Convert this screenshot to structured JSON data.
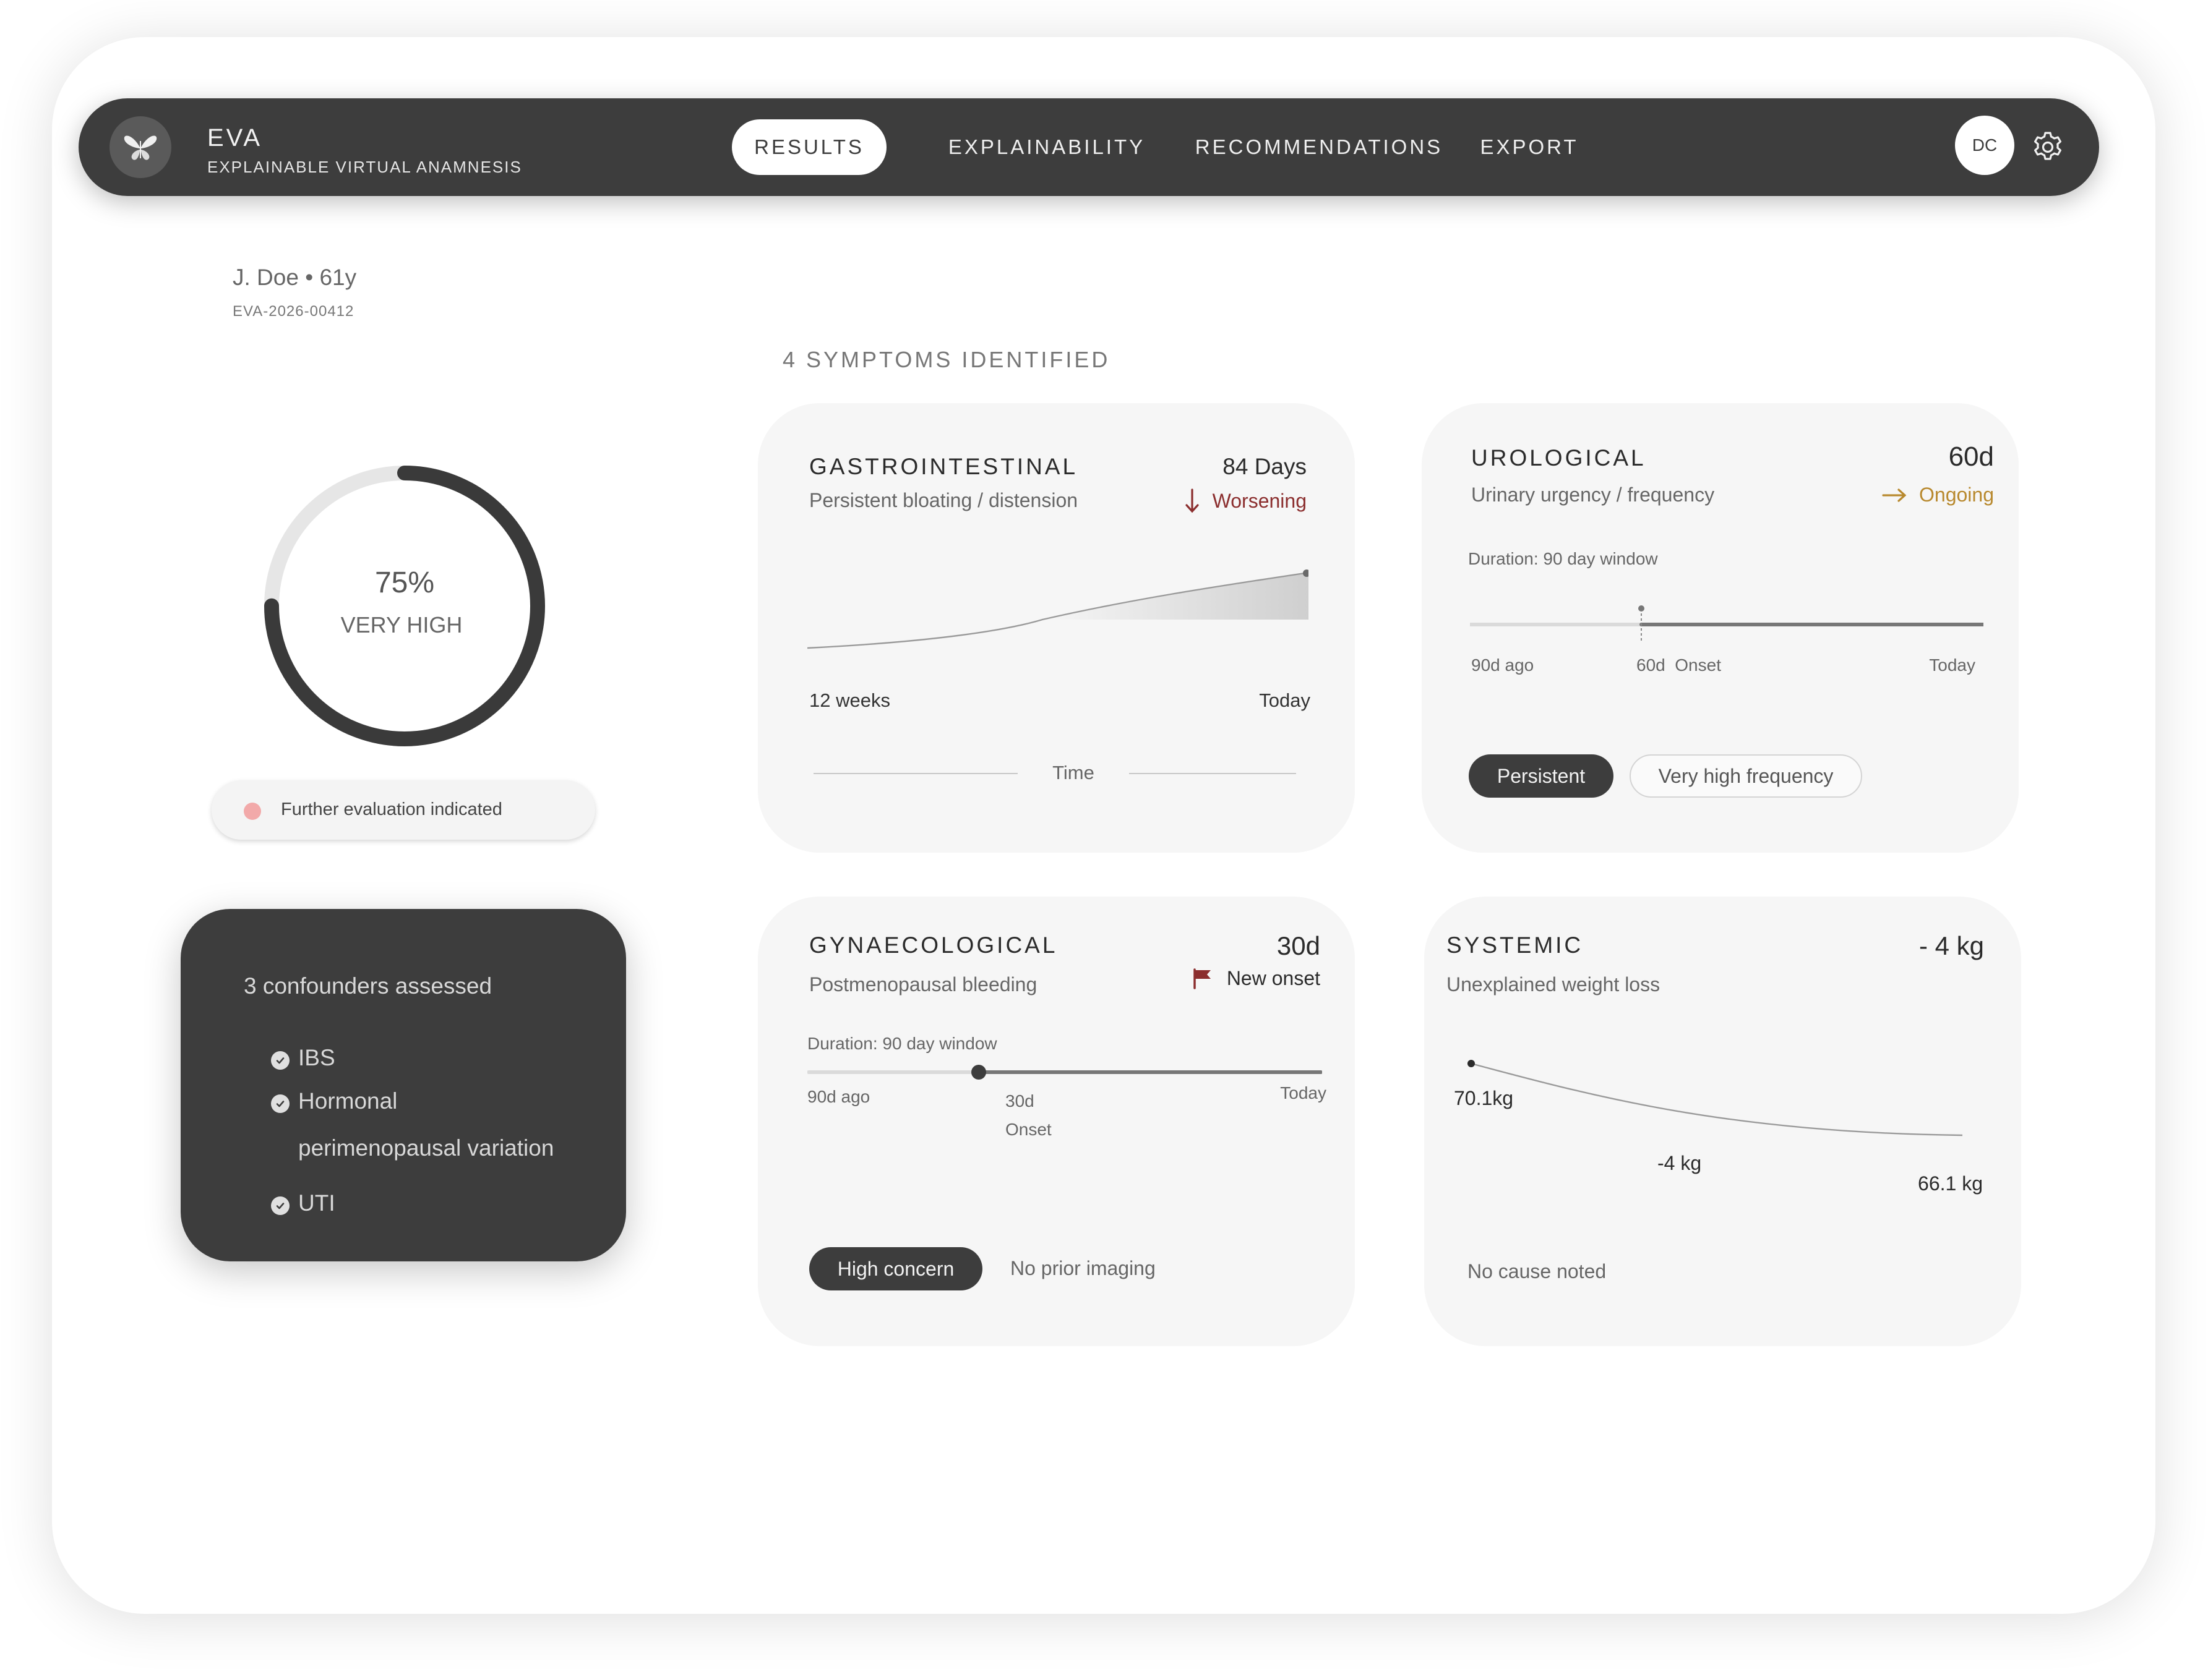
{
  "app": {
    "title": "EVA",
    "subtitle": "EXPLAINABLE VIRTUAL ANAMNESIS",
    "logo_icon": "butterfly-icon"
  },
  "nav": {
    "tabs": [
      {
        "label": "RESULTS",
        "active": true
      },
      {
        "label": "EXPLAINABILITY",
        "active": false
      },
      {
        "label": "RECOMMENDATIONS",
        "active": false
      },
      {
        "label": "EXPORT",
        "active": false
      }
    ],
    "user_initials": "DC",
    "settings_icon": "gear-icon"
  },
  "patient": {
    "name_age": "J. Doe • 61y",
    "id": "EVA-2026-00412"
  },
  "risk": {
    "percent_label": "75%",
    "percent_value": 75,
    "level": "VERY HIGH",
    "status": "Further evaluation indicated",
    "status_color": "#f2a9a9"
  },
  "confounders": {
    "title": "3 confounders assessed",
    "items": [
      {
        "line1": "IBS",
        "line2": ""
      },
      {
        "line1": "Hormonal",
        "line2": "perimenopausal variation"
      },
      {
        "line1": "UTI",
        "line2": ""
      }
    ]
  },
  "symptoms": {
    "heading": "4 SYMPTOMS IDENTIFIED",
    "gastro": {
      "title": "GASTROINTESTINAL",
      "subtitle": "Persistent bloating / distension",
      "value": "84 Days",
      "trend": "Worsening",
      "trend_color": "#8b2e2e",
      "x_start": "12 weeks",
      "x_end": "Today",
      "axis_label": "Time"
    },
    "uro": {
      "title": "UROLOGICAL",
      "subtitle": "Urinary urgency / frequency",
      "value": "60d",
      "trend": "Ongoing",
      "trend_color": "#b8892e",
      "window": "Duration: 90 day window",
      "t_start": "90d ago",
      "t_mid": "60d",
      "t_mid_label": "Onset",
      "t_end": "Today",
      "onset_fraction": 0.3333,
      "tags": [
        "Persistent",
        "Very high frequency"
      ]
    },
    "gyn": {
      "title": "GYNAECOLOGICAL",
      "subtitle": "Postmenopausal bleeding",
      "value": "30d",
      "flag": "New onset",
      "flag_color": "#8b2e2e",
      "window": "Duration: 90 day window",
      "t_start": "90d ago",
      "t_mid": "30d",
      "t_mid_label": "Onset",
      "t_end": "Today",
      "onset_fraction": 0.3333,
      "tags": [
        "High concern",
        "No prior imaging"
      ]
    },
    "sys": {
      "title": "SYSTEMIC",
      "subtitle": "Unexplained weight loss",
      "value": "- 4 kg",
      "start_weight": "70.1kg",
      "delta": "-4 kg",
      "end_weight": "66.1 kg",
      "note": "No cause noted"
    }
  }
}
